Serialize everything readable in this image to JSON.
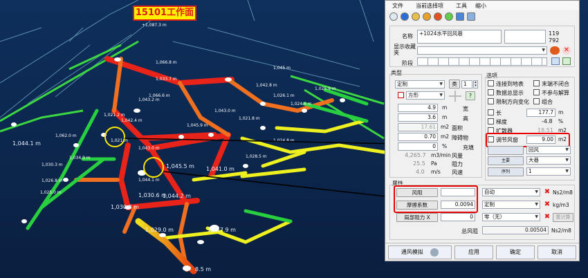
{
  "scene": {
    "work_face_label": "15101工作面",
    "pipe_labels": [
      "+1,087.3 m",
      "1,044.1 m",
      "1,030.8 m",
      "1,029.0 m",
      "1,027.9 m",
      "1,030.6 m",
      "1,045.5 m",
      "1,044.2 m",
      "1,041.0 m",
      "1,043.0 m",
      "1,043.0 m",
      "1,044.1 m",
      "1,042.4 m",
      "1,043.2 m",
      "1,033.7 m",
      "1,045.9 m",
      "1,026.8 m",
      "1,034.9 m",
      "1,030.3 m",
      "1,021 m",
      "1,021.2 m",
      "1,021.8 m",
      "1,026.1 m",
      "1,066.6 m",
      "1,042.8 m",
      "1,024.6 m",
      "1,025.9 m",
      "1,062.0 m",
      "1,066.8 m",
      "1,028.5 m",
      "1,045 m",
      "1,024.8 m",
      "1,025.0 m",
      "8.5 m"
    ]
  },
  "dialog": {
    "menu": [
      "文件",
      "当前选择项",
      "工具",
      "缩小"
    ],
    "toolbar_icons": [
      "back-icon",
      "info-icon",
      "gear-icon",
      "fan-icon",
      "alert-icon",
      "chat-icon",
      "chart-icon",
      "export-icon"
    ],
    "name_label": "名称",
    "name_value": "+1024水平回风巷",
    "id1": "119",
    "id2": "792",
    "fav_label": "显示收藏夹",
    "fav_value": "",
    "stage_label": "阶段",
    "type_section": "类型",
    "type_value": "定制",
    "class_label": "类",
    "class_value": "1",
    "shape_value": "方形",
    "help_label": "?",
    "width_value": "4.9",
    "width_unit": "m",
    "width_label": "宽",
    "height_value": "3.6",
    "height_unit": "m",
    "height_label": "高",
    "area_value": "17.61",
    "area_unit": "m2",
    "area_label": "面积",
    "obstacle_value": "0.70",
    "obstacle_unit": "m2",
    "obstacle_label": "障碍物",
    "fill_value": "0",
    "fill_unit": "%",
    "fill_label": "充填",
    "airflow_value": "4,265.7",
    "airflow_unit": "m3/min",
    "airflow_label": "风量",
    "resistance_value": "25.5",
    "resistance_unit": "Pa",
    "resistance_label": "阻力",
    "velocity_value": "4.0",
    "velocity_unit": "m/s",
    "velocity_label": "风速",
    "options_section": "选项",
    "opt_check": [
      "连接到地表",
      "数据总显示",
      "限制方向变化"
    ],
    "opt_check_right": [
      "末端不闭合",
      "不参与解算",
      "组合"
    ],
    "length_label": "长",
    "length_value": "177.7",
    "length_unit": "m",
    "slope_label": "梯度",
    "slope_value": "-4.8",
    "slope_unit": "%",
    "diffuser_label": "扩散器",
    "diffuser_value": "18.51",
    "diffuser_unit": "m2",
    "adjust_label": "调节风窗",
    "adjust_value": "9.00",
    "adjust_unit": "m2",
    "adjust_dd_value": "回风",
    "main_btn": "主要",
    "main_value": "大巷",
    "seq_btn": "序列",
    "seq_value": "1",
    "prop_section": "属性",
    "wind_res_btn": "风阻",
    "wind_res_value": "",
    "wind_res_mode": "自动",
    "wind_res_unit": "Ns2/m8",
    "friction_btn": "摩擦系数",
    "friction_value": "0.0094",
    "friction_mode": "定制",
    "friction_unit": "kg/m3",
    "local_res_btn": "局部阻力 X",
    "local_res_value": "0",
    "local_res_mode": "零（无）",
    "recalc_btn": "重计算",
    "total_res_label": "总风阻",
    "total_res_value": "0.00504",
    "total_res_unit": "Ns2/m8",
    "sim_btn": "通风模拟",
    "apply_btn": "应用",
    "ok_btn": "确定",
    "cancel_btn": "取消"
  }
}
